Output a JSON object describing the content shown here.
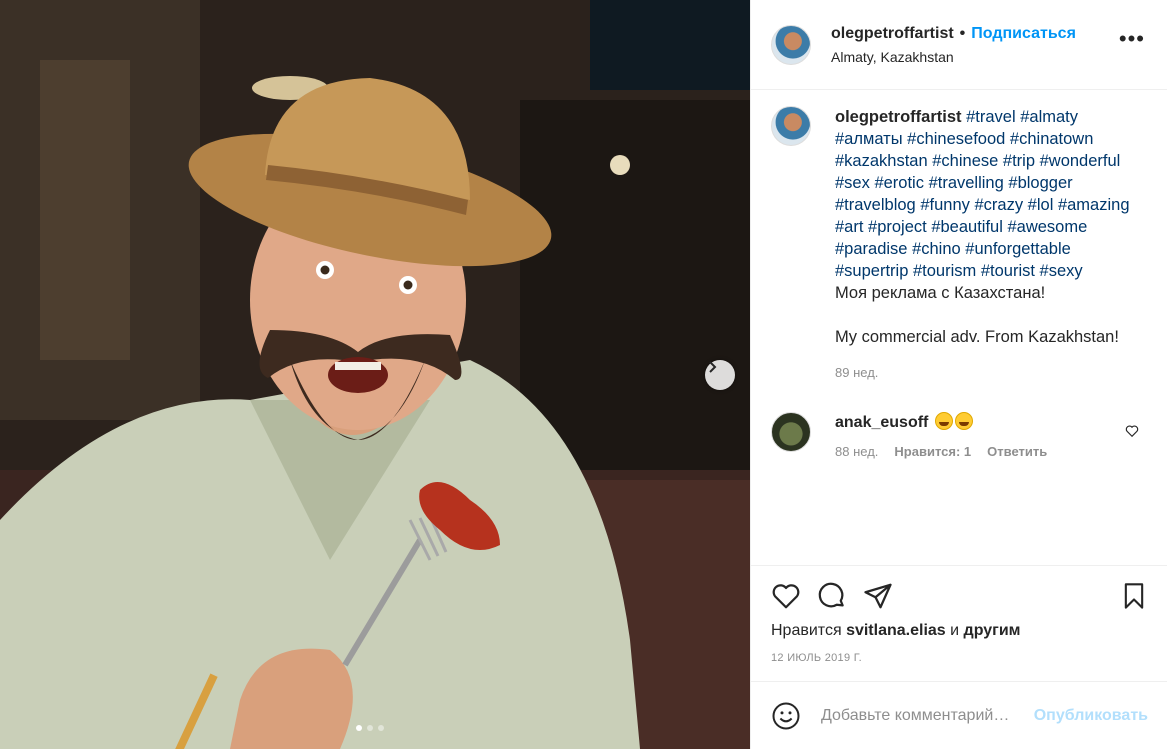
{
  "post": {
    "username": "olegpetroffartist",
    "follow_label": "Подписаться",
    "location": "Almaty, Kazakhstan"
  },
  "caption": {
    "username": "olegpetroffartist",
    "hashtags": [
      "#travel",
      "#almaty",
      "#алматы",
      "#chinesefood",
      "#chinatown",
      "#kazakhstan",
      "#chinese",
      "#trip",
      "#wonderful",
      "#sex",
      "#erotic",
      "#travelling",
      "#blogger",
      "#travelblog",
      "#funny",
      "#crazy",
      "#lol",
      "#amazing",
      "#art",
      "#project",
      "#beautiful",
      "#awesome",
      "#paradise",
      "#chino",
      "#unforgettable",
      "#supertrip",
      "#tourism",
      "#tourist",
      "#sexy"
    ],
    "line1": "Моя реклама с Казахстана!",
    "line2": "My commercial adv. From Kazakhstan!",
    "time": "89 нед."
  },
  "comment": {
    "username": "anak_eusoff",
    "time": "88 нед.",
    "likes": "Нравится: 1",
    "reply": "Ответить"
  },
  "likes": {
    "prefix": "Нравится",
    "user": "svitlana.elias",
    "middle": "и",
    "suffix": "другим"
  },
  "date": "12 ИЮЛЬ 2019 Г.",
  "add_comment": {
    "placeholder": "Добавьте комментарий…",
    "publish_label": "Опубликовать"
  },
  "carousel": {
    "slides": 3,
    "active": 0
  },
  "colors": {
    "accent": "#0095f6",
    "hashtag": "#00376b",
    "muted": "#8e8e8e",
    "publish_disabled": "#b2dffc"
  }
}
